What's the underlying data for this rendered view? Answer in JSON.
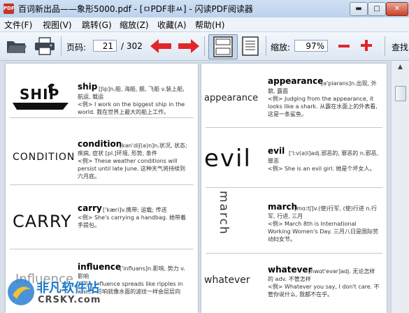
{
  "window": {
    "title": "百词新出品——象形5000.pdf - [ㅁPDF非ㅆ] - 闪读PDF阅读器",
    "app_icon_text": "PDF",
    "controls": {
      "minimize": "▬",
      "maximize": "□",
      "close": "✕"
    }
  },
  "menu": [
    {
      "label": "文件(F)"
    },
    {
      "label": "视图(V)"
    },
    {
      "label": "跳转(G)"
    },
    {
      "label": "缩放(Z)"
    },
    {
      "label": "收藏(A)"
    },
    {
      "label": "帮助(H)"
    }
  ],
  "toolbar": {
    "page_label": "页码:",
    "page_value": "21",
    "page_total": "/ 302",
    "zoom_label": "缩放:",
    "zoom_value": "97%",
    "search_label": "查找",
    "colors": {
      "arrow": "#e0262a",
      "plus_minus": "#e0262a"
    }
  },
  "left_page": [
    {
      "logo": "SHIP",
      "word": "ship",
      "phonetic": "[ʃip]n.船, 海船, 舰, 飞船 v.装上船, 航运, 载运",
      "example": "I work on the biggest ship in the world. 我在世界上最大的船上工作。"
    },
    {
      "logo": "CONDITION",
      "word": "condition",
      "phonetic": "[kən'diʃ(ə)n]n.状况, 状态; 疾病, 症状 [pl.]环境, 形势, 条件",
      "example": "These weather conditions will persist until late June. 这种天气将持续到六月底。"
    },
    {
      "logo": "CARRY",
      "word": "carry",
      "phonetic": "['kæri]v.携带; 运载; 传送",
      "example": "She's carrying a handbag. 她带着手提包。"
    },
    {
      "logo": "Influence",
      "word": "influence",
      "phonetic": "['influəns]n.影响, 势力 v.影响",
      "example": "Influence spreads like ripples in water. 影响就像水面的波纹一样会层层向"
    }
  ],
  "right_page": [
    {
      "logo": "appearance",
      "word": "appearance",
      "phonetic": "[ə'piərəns]n.出现, 外貌, 露面",
      "example": "Judging from the appearance, it looks like a shark. 从露在水面上的外表看, 这是一条鲨鱼。"
    },
    {
      "logo": "evil",
      "word": "evil",
      "phonetic": "['i:v(ə)l]adj.邪恶的, 罪恶的 n.邪恶, 罪恶",
      "example": "She is an evil girl. 她是个坏女人。"
    },
    {
      "logo": "march",
      "word": "march",
      "phonetic": "[mɑ:tʃ]v.(使)行军, (使)行进 n.行军, 行进, 三月",
      "example": "March 8th is International Working Women's Day. 三月八日是国际劳动妇女节。"
    },
    {
      "logo": "whatever",
      "word": "whatever",
      "phonetic": "[hwɑt'evər]adj. 无论怎样的 adv. 不管怎样",
      "example": "Whatever you say, I don't care. 不管你说什么, 我都不在乎。"
    }
  ],
  "example_marker": "<例>",
  "watermark": {
    "line1": "非凡软件站",
    "line2": "CRSKY.com"
  }
}
